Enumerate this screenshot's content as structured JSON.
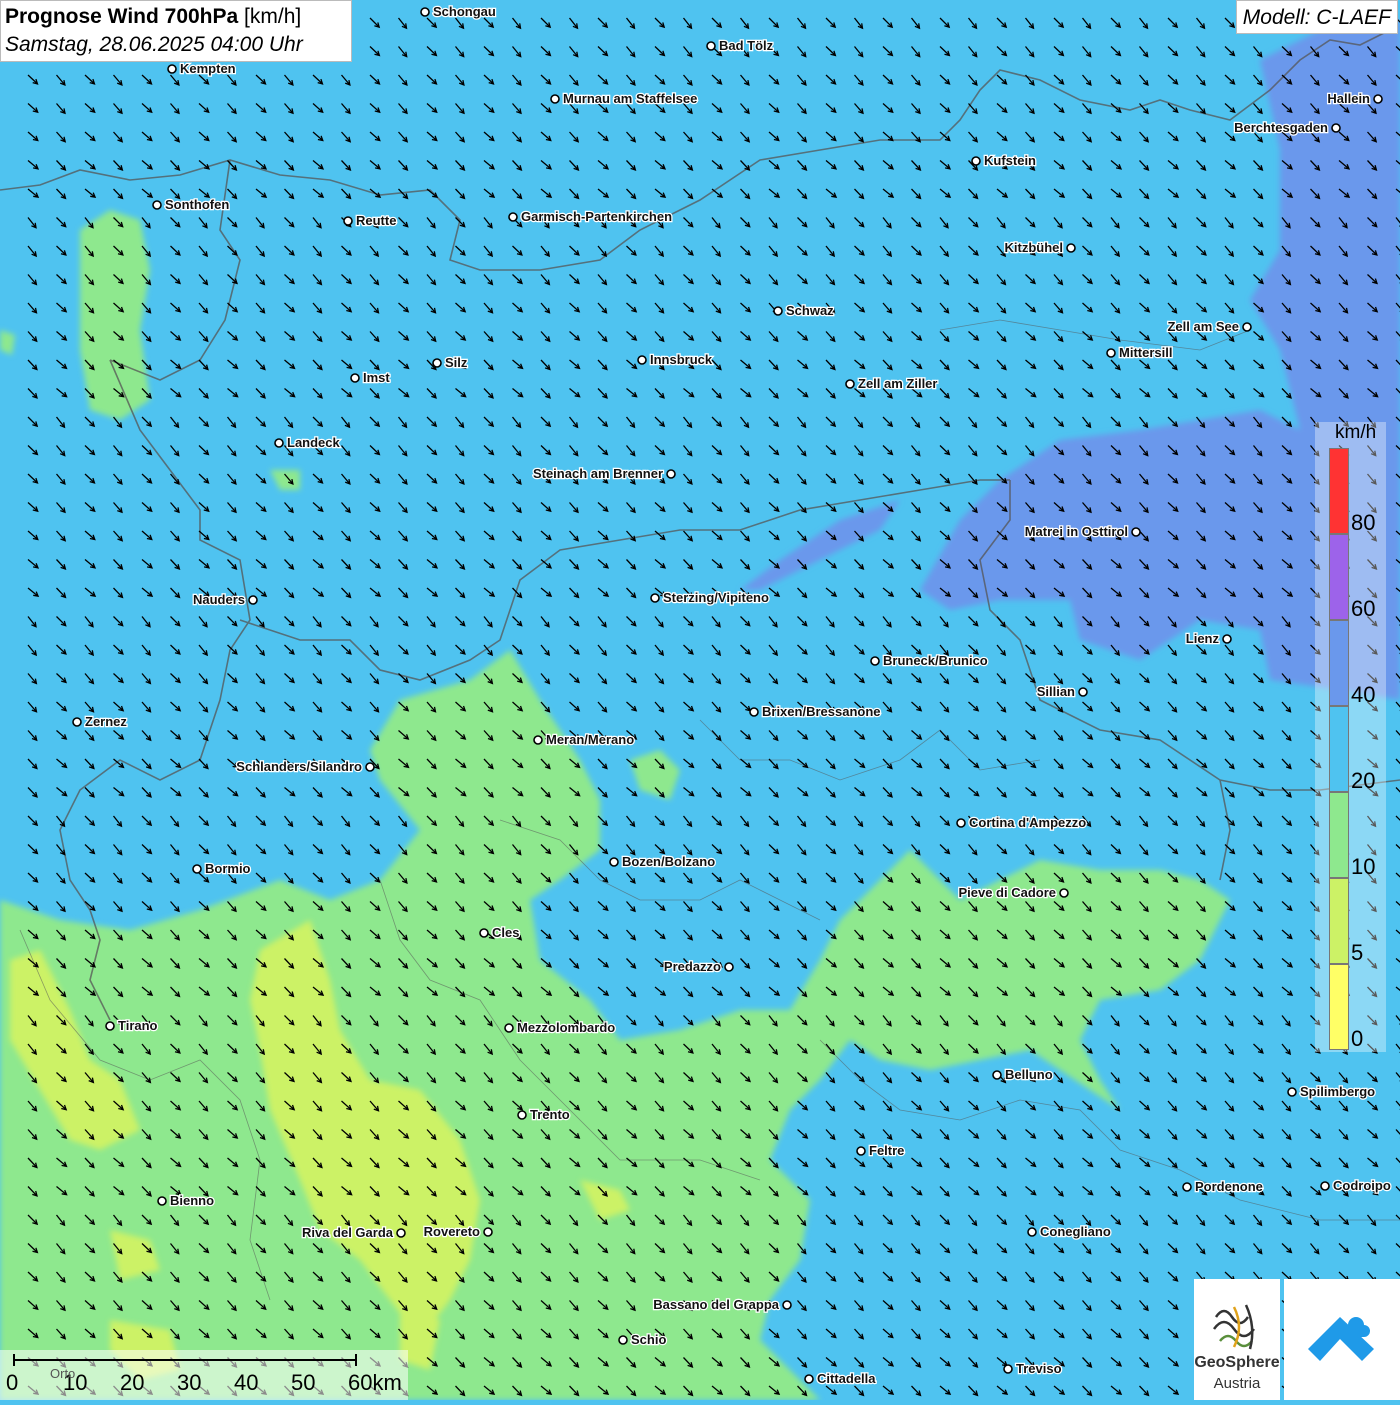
{
  "title": {
    "main": "Prognose Wind 700hPa",
    "unit": "[km/h]",
    "date": "Samstag, 28.06.2025 04:00 Uhr"
  },
  "model": "Modell: C-LAEF",
  "legend": {
    "unit": "km/h",
    "steps": [
      {
        "label": "0",
        "color": "#ffff66"
      },
      {
        "label": "5",
        "color": "#ccf266"
      },
      {
        "label": "10",
        "color": "#8ee88e"
      },
      {
        "label": "20",
        "color": "#4fc3f0"
      },
      {
        "label": "40",
        "color": "#6a98ec"
      },
      {
        "label": "60",
        "color": "#9d63ea"
      },
      {
        "label": "80",
        "color": "#ff3333"
      }
    ]
  },
  "scale_bar": {
    "labels": [
      "0",
      "10",
      "20",
      "30",
      "40",
      "50",
      "60km"
    ],
    "place_label": "Orto"
  },
  "logos": {
    "geosphere_line1": "GeoSphere",
    "geosphere_line2": "Austria"
  },
  "cities": [
    {
      "name": "Schongau"
    },
    {
      "name": "Bad Tölz"
    },
    {
      "name": "Kempten"
    },
    {
      "name": "Murnau am Staffelsee"
    },
    {
      "name": "Hallein"
    },
    {
      "name": "Berchtesgaden"
    },
    {
      "name": "Kufstein"
    },
    {
      "name": "Sonthofen"
    },
    {
      "name": "Reutte"
    },
    {
      "name": "Garmisch-Partenkirchen"
    },
    {
      "name": "Kitzbühel"
    },
    {
      "name": "Schwaz"
    },
    {
      "name": "Zell am See"
    },
    {
      "name": "Innsbruck"
    },
    {
      "name": "Mittersill"
    },
    {
      "name": "Silz"
    },
    {
      "name": "Imst"
    },
    {
      "name": "Zell am Ziller"
    },
    {
      "name": "Landeck"
    },
    {
      "name": "Steinach am Brenner"
    },
    {
      "name": "Matrei in Osttirol"
    },
    {
      "name": "Nauders"
    },
    {
      "name": "Sterzing/Vipiteno"
    },
    {
      "name": "Lienz"
    },
    {
      "name": "Bruneck/Brunico"
    },
    {
      "name": "Sillian"
    },
    {
      "name": "Brixen/Bressanone"
    },
    {
      "name": "Zernez"
    },
    {
      "name": "Meran/Merano"
    },
    {
      "name": "Schlanders/Silandro"
    },
    {
      "name": "Cortina d'Ampezzo"
    },
    {
      "name": "Bozen/Bolzano"
    },
    {
      "name": "Bormio"
    },
    {
      "name": "Pieve di Cadore"
    },
    {
      "name": "Cles"
    },
    {
      "name": "Predazzo"
    },
    {
      "name": "Tirano"
    },
    {
      "name": "Mezzolombardo"
    },
    {
      "name": "Belluno"
    },
    {
      "name": "Spilimbergo"
    },
    {
      "name": "Trento"
    },
    {
      "name": "Feltre"
    },
    {
      "name": "Pordenone"
    },
    {
      "name": "Codroipo"
    },
    {
      "name": "Bienno"
    },
    {
      "name": "Riva del Garda"
    },
    {
      "name": "Rovereto"
    },
    {
      "name": "Conegliano"
    },
    {
      "name": "Bassano del Grappa"
    },
    {
      "name": "Schio"
    },
    {
      "name": "Treviso"
    },
    {
      "name": "Cittadella"
    }
  ]
}
